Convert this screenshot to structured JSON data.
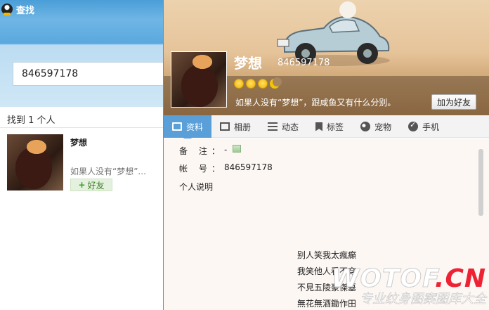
{
  "window": {
    "title": "查找"
  },
  "search": {
    "value": "846597178"
  },
  "results": {
    "count_text": "找到 1 个人",
    "items": [
      {
        "name": "梦想",
        "desc": "如果人没有“梦想”...",
        "add_label": "好友"
      }
    ]
  },
  "profile": {
    "name": "梦想",
    "qq": "846597178",
    "signature": "如果人没有“梦想”，跟咸鱼又有什么分别。",
    "add_button": "加为好友",
    "level_icons": [
      "sun-icon",
      "sun-icon",
      "sun-icon",
      "moon-icon"
    ]
  },
  "tabs": [
    {
      "label": "资料",
      "icon": "id-card-icon",
      "active": true
    },
    {
      "label": "相册",
      "icon": "album-icon"
    },
    {
      "label": "动态",
      "icon": "feed-icon"
    },
    {
      "label": "标签",
      "icon": "tag-icon"
    },
    {
      "label": "宠物",
      "icon": "pet-icon"
    },
    {
      "label": "手机",
      "icon": "phone-icon"
    }
  ],
  "details": {
    "remark_label": "备 注：",
    "remark_value": "-",
    "account_label": "帐 号：",
    "account_value": "846597178",
    "intro_label": "个人说明",
    "poem": [
      "别人笑我太瘋癲",
      "我笑他人看不穿",
      "不見五陵豪傑墓",
      "無花無酒鋤作田"
    ]
  },
  "watermark": {
    "big": "WOTOF",
    "big_suffix": ".CN",
    "small": "专业纹身图案图库大全"
  },
  "colors": {
    "accent": "#5a9fd8",
    "add_green": "#3c7f2a"
  }
}
